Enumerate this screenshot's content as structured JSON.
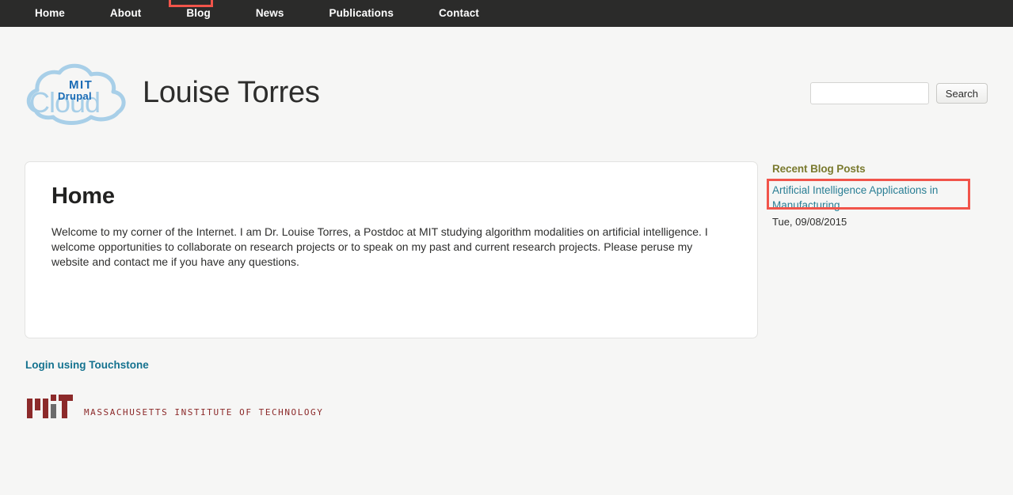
{
  "nav": {
    "items": [
      {
        "label": "Home",
        "active": false
      },
      {
        "label": "About",
        "active": false
      },
      {
        "label": "Blog",
        "active": true
      },
      {
        "label": "News",
        "active": false
      },
      {
        "label": "Publications",
        "active": false
      },
      {
        "label": "Contact",
        "active": false
      }
    ],
    "highlight_target": "Blog",
    "background_color": "#2b2b2a",
    "text_color": "#ffffff",
    "highlight_color": "#f1544a"
  },
  "logo": {
    "name": "mit-drupal-cloud-logo",
    "word_cloud": "Cloud",
    "word_mit": "MIT",
    "word_drupal": "Drupal",
    "cloud_color": "#a8cfe8",
    "text_color": "#1a6bb5"
  },
  "header": {
    "site_title": "Louise Torres"
  },
  "search": {
    "value": "",
    "placeholder": "",
    "button_label": "Search"
  },
  "main": {
    "heading": "Home",
    "body": "Welcome to my corner of the Internet. I am Dr. Louise Torres, a Postdoc at MIT studying algorithm modalities on artificial intelligence. I welcome opportunities to collaborate on research projects or to speak on my past and current research projects. Please peruse my website and contact me if you have any questions."
  },
  "sidebar": {
    "title": "Recent Blog Posts",
    "title_color": "#7a7a2e",
    "posts": [
      {
        "title": "Artificial Intelligence Applications in Manufacturing",
        "date": "Tue, 09/08/2015",
        "highlighted": true
      }
    ]
  },
  "footer": {
    "touchstone_label": "Login using Touchstone",
    "touchstone_color": "#14728f",
    "mit_wordmark": "MASSACHUSETTS INSTITUTE OF TECHNOLOGY",
    "mit_color": "#8c2a2a",
    "mit_gray_bar_color": "#6b6b6b"
  }
}
